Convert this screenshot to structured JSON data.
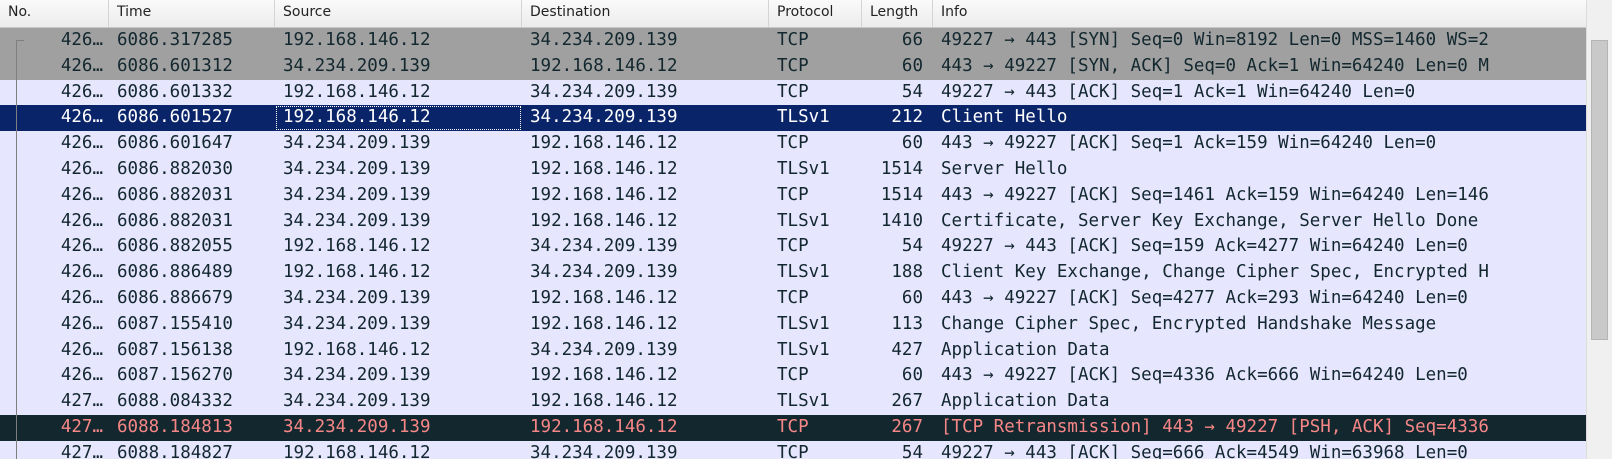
{
  "columns": {
    "no": "No.",
    "time": "Time",
    "source": "Source",
    "destination": "Destination",
    "protocol": "Protocol",
    "length": "Length",
    "info": "Info"
  },
  "rows": [
    {
      "no": "426…",
      "time": "6086.317285",
      "src": "192.168.146.12",
      "dst": "34.234.209.139",
      "proto": "TCP",
      "len": "66",
      "info": "49227 → 443 [SYN] Seq=0 Win=8192 Len=0 MSS=1460 WS=2",
      "style": "syn"
    },
    {
      "no": "426…",
      "time": "6086.601312",
      "src": "34.234.209.139",
      "dst": "192.168.146.12",
      "proto": "TCP",
      "len": "60",
      "info": "443 → 49227 [SYN, ACK] Seq=0 Ack=1 Win=64240 Len=0 M",
      "style": "syn"
    },
    {
      "no": "426…",
      "time": "6086.601332",
      "src": "192.168.146.12",
      "dst": "34.234.209.139",
      "proto": "TCP",
      "len": "54",
      "info": "49227 → 443 [ACK] Seq=1 Ack=1 Win=64240 Len=0",
      "style": "normal"
    },
    {
      "no": "426…",
      "time": "6086.601527",
      "src": "192.168.146.12",
      "dst": "34.234.209.139",
      "proto": "TLSv1",
      "len": "212",
      "info": "Client Hello",
      "style": "selected"
    },
    {
      "no": "426…",
      "time": "6086.601647",
      "src": "34.234.209.139",
      "dst": "192.168.146.12",
      "proto": "TCP",
      "len": "60",
      "info": "443 → 49227 [ACK] Seq=1 Ack=159 Win=64240 Len=0",
      "style": "normal"
    },
    {
      "no": "426…",
      "time": "6086.882030",
      "src": "34.234.209.139",
      "dst": "192.168.146.12",
      "proto": "TLSv1",
      "len": "1514",
      "info": "Server Hello",
      "style": "normal"
    },
    {
      "no": "426…",
      "time": "6086.882031",
      "src": "34.234.209.139",
      "dst": "192.168.146.12",
      "proto": "TCP",
      "len": "1514",
      "info": "443 → 49227 [ACK] Seq=1461 Ack=159 Win=64240 Len=146",
      "style": "normal"
    },
    {
      "no": "426…",
      "time": "6086.882031",
      "src": "34.234.209.139",
      "dst": "192.168.146.12",
      "proto": "TLSv1",
      "len": "1410",
      "info": "Certificate, Server Key Exchange, Server Hello Done",
      "style": "normal"
    },
    {
      "no": "426…",
      "time": "6086.882055",
      "src": "192.168.146.12",
      "dst": "34.234.209.139",
      "proto": "TCP",
      "len": "54",
      "info": "49227 → 443 [ACK] Seq=159 Ack=4277 Win=64240 Len=0",
      "style": "normal"
    },
    {
      "no": "426…",
      "time": "6086.886489",
      "src": "192.168.146.12",
      "dst": "34.234.209.139",
      "proto": "TLSv1",
      "len": "188",
      "info": "Client Key Exchange, Change Cipher Spec, Encrypted H",
      "style": "normal"
    },
    {
      "no": "426…",
      "time": "6086.886679",
      "src": "34.234.209.139",
      "dst": "192.168.146.12",
      "proto": "TCP",
      "len": "60",
      "info": "443 → 49227 [ACK] Seq=4277 Ack=293 Win=64240 Len=0",
      "style": "normal"
    },
    {
      "no": "426…",
      "time": "6087.155410",
      "src": "34.234.209.139",
      "dst": "192.168.146.12",
      "proto": "TLSv1",
      "len": "113",
      "info": "Change Cipher Spec, Encrypted Handshake Message",
      "style": "normal"
    },
    {
      "no": "426…",
      "time": "6087.156138",
      "src": "192.168.146.12",
      "dst": "34.234.209.139",
      "proto": "TLSv1",
      "len": "427",
      "info": "Application Data",
      "style": "normal"
    },
    {
      "no": "426…",
      "time": "6087.156270",
      "src": "34.234.209.139",
      "dst": "192.168.146.12",
      "proto": "TCP",
      "len": "60",
      "info": "443 → 49227 [ACK] Seq=4336 Ack=666 Win=64240 Len=0",
      "style": "normal"
    },
    {
      "no": "427…",
      "time": "6088.084332",
      "src": "34.234.209.139",
      "dst": "192.168.146.12",
      "proto": "TLSv1",
      "len": "267",
      "info": "Application Data",
      "style": "normal"
    },
    {
      "no": "427…",
      "time": "6088.184813",
      "src": "34.234.209.139",
      "dst": "192.168.146.12",
      "proto": "TCP",
      "len": "267",
      "info": "[TCP Retransmission] 443 → 49227 [PSH, ACK] Seq=4336",
      "style": "bad"
    },
    {
      "no": "427…",
      "time": "6088.184827",
      "src": "192.168.146.12",
      "dst": "34.234.209.139",
      "proto": "TCP",
      "len": "54",
      "info": "49227 → 443 [ACK] Seq=666 Ack=4549 Win=63968 Len=0",
      "style": "normal"
    }
  ],
  "colors": {
    "normal_bg": "#e7e6ff",
    "syn_bg": "#a0a0a0",
    "selected_bg": "#0a246a",
    "bad_bg": "#12272e",
    "bad_fg": "#f78787"
  }
}
